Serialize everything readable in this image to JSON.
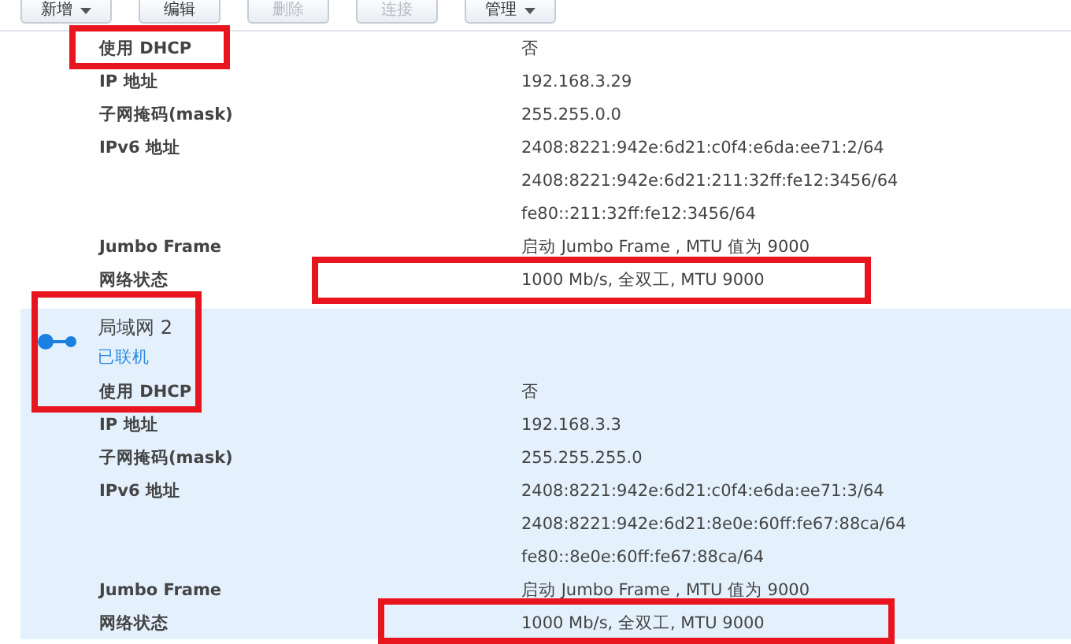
{
  "toolbar": {
    "buttons": [
      {
        "label": "新增",
        "dropdown": true,
        "disabled": false
      },
      {
        "label": "编辑",
        "dropdown": false,
        "disabled": false
      },
      {
        "label": "删除",
        "dropdown": false,
        "disabled": true
      },
      {
        "label": "连接",
        "dropdown": false,
        "disabled": true
      },
      {
        "label": "管理",
        "dropdown": true,
        "disabled": false
      }
    ]
  },
  "interfaces": [
    {
      "selected": false,
      "rows": [
        {
          "label": "使用 DHCP",
          "values": [
            "否"
          ]
        },
        {
          "label": "IP 地址",
          "values": [
            "192.168.3.29"
          ]
        },
        {
          "label": "子网掩码(mask)",
          "values": [
            "255.255.0.0"
          ]
        },
        {
          "label": "IPv6 地址",
          "values": [
            "2408:8221:942e:6d21:c0f4:e6da:ee71:2/64",
            "2408:8221:942e:6d21:211:32ff:fe12:3456/64",
            "fe80::211:32ff:fe12:3456/64"
          ]
        },
        {
          "label": "Jumbo Frame",
          "values": [
            "启动 Jumbo Frame , MTU 值为 9000"
          ]
        },
        {
          "label": "网络状态",
          "values": [
            "1000 Mb/s, 全双工, MTU 9000"
          ]
        }
      ]
    },
    {
      "title": "局域网 2",
      "status": "已联机",
      "connected": true,
      "selected": true,
      "rows": [
        {
          "label": "使用 DHCP",
          "values": [
            "否"
          ]
        },
        {
          "label": "IP 地址",
          "values": [
            "192.168.3.3"
          ]
        },
        {
          "label": "子网掩码(mask)",
          "values": [
            "255.255.255.0"
          ]
        },
        {
          "label": "IPv6 地址",
          "values": [
            "2408:8221:942e:6d21:c0f4:e6da:ee71:3/64",
            "2408:8221:942e:6d21:8e0e:60ff:fe67:88ca/64",
            "fe80::8e0e:60ff:fe67:88ca/64"
          ]
        },
        {
          "label": "Jumbo Frame",
          "values": [
            "启动 Jumbo Frame , MTU 值为 9000"
          ]
        },
        {
          "label": "网络状态",
          "values": [
            "1000 Mb/s, 全双工, MTU 9000"
          ]
        }
      ]
    }
  ]
}
